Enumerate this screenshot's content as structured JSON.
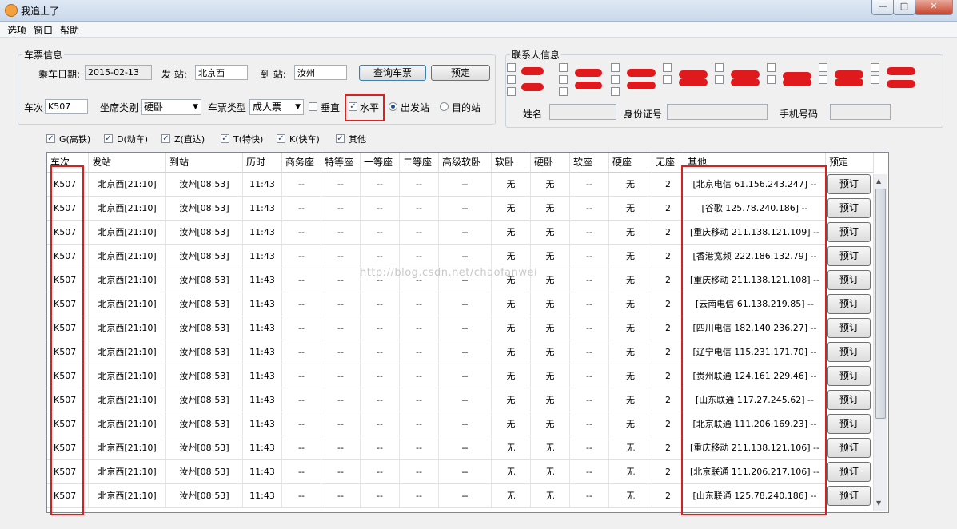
{
  "window": {
    "title": "我追上了",
    "minimize": "—",
    "maximize": "□",
    "close": "✕"
  },
  "menu": [
    "选项",
    "窗口",
    "帮助"
  ],
  "ticket": {
    "group_label": "车票信息",
    "date_label": "乘车日期:",
    "date_value": "2015-02-13",
    "from_label": "发 站:",
    "from_value": "北京西",
    "to_label": "到 站:",
    "to_value": "汝州",
    "query_button": "查询车票",
    "book_button": "预定",
    "train_label": "车次",
    "train_value": "K507",
    "seat_label": "坐席类别",
    "seat_value": "硬卧",
    "ticket_type_label": "车票类型",
    "ticket_type_value": "成人票",
    "vertical_label": "垂直",
    "vertical_checked": false,
    "horizontal_label": "水平",
    "horizontal_checked": true,
    "depart_label": "出发站",
    "dest_label": "目的站",
    "station_mode": "出发站"
  },
  "contacts": {
    "group_label": "联系人信息",
    "name_label": "姓名",
    "id_label": "身份证号",
    "phone_label": "手机号码"
  },
  "filters": [
    {
      "label": "G(高铁)",
      "checked": true
    },
    {
      "label": "D(动车)",
      "checked": true
    },
    {
      "label": "Z(直达)",
      "checked": true
    },
    {
      "label": "T(特快)",
      "checked": true
    },
    {
      "label": "K(快车)",
      "checked": true
    },
    {
      "label": "其他",
      "checked": true
    }
  ],
  "table": {
    "columns": [
      "车次",
      "发站",
      "到站",
      "历时",
      "商务座",
      "特等座",
      "一等座",
      "二等座",
      "高级软卧",
      "软卧",
      "硬卧",
      "软座",
      "硬座",
      "无座",
      "其他",
      "预定"
    ],
    "book_label": "预订",
    "rows": [
      [
        "K507",
        "北京西[21:10]",
        "汝州[08:53]",
        "11:43",
        "--",
        "--",
        "--",
        "--",
        "--",
        "无",
        "无",
        "--",
        "无",
        "2",
        "[北京电信 61.156.243.247] --"
      ],
      [
        "K507",
        "北京西[21:10]",
        "汝州[08:53]",
        "11:43",
        "--",
        "--",
        "--",
        "--",
        "--",
        "无",
        "无",
        "--",
        "无",
        "2",
        "[谷歌 125.78.240.186] --"
      ],
      [
        "K507",
        "北京西[21:10]",
        "汝州[08:53]",
        "11:43",
        "--",
        "--",
        "--",
        "--",
        "--",
        "无",
        "无",
        "--",
        "无",
        "2",
        "[重庆移动 211.138.121.109] --"
      ],
      [
        "K507",
        "北京西[21:10]",
        "汝州[08:53]",
        "11:43",
        "--",
        "--",
        "--",
        "--",
        "--",
        "无",
        "无",
        "--",
        "无",
        "2",
        "[香港宽频 222.186.132.79] --"
      ],
      [
        "K507",
        "北京西[21:10]",
        "汝州[08:53]",
        "11:43",
        "--",
        "--",
        "--",
        "--",
        "--",
        "无",
        "无",
        "--",
        "无",
        "2",
        "[重庆移动 211.138.121.108] --"
      ],
      [
        "K507",
        "北京西[21:10]",
        "汝州[08:53]",
        "11:43",
        "--",
        "--",
        "--",
        "--",
        "--",
        "无",
        "无",
        "--",
        "无",
        "2",
        "[云南电信 61.138.219.85] --"
      ],
      [
        "K507",
        "北京西[21:10]",
        "汝州[08:53]",
        "11:43",
        "--",
        "--",
        "--",
        "--",
        "--",
        "无",
        "无",
        "--",
        "无",
        "2",
        "[四川电信 182.140.236.27] --"
      ],
      [
        "K507",
        "北京西[21:10]",
        "汝州[08:53]",
        "11:43",
        "--",
        "--",
        "--",
        "--",
        "--",
        "无",
        "无",
        "--",
        "无",
        "2",
        "[辽宁电信 115.231.171.70] --"
      ],
      [
        "K507",
        "北京西[21:10]",
        "汝州[08:53]",
        "11:43",
        "--",
        "--",
        "--",
        "--",
        "--",
        "无",
        "无",
        "--",
        "无",
        "2",
        "[贵州联通 124.161.229.46] --"
      ],
      [
        "K507",
        "北京西[21:10]",
        "汝州[08:53]",
        "11:43",
        "--",
        "--",
        "--",
        "--",
        "--",
        "无",
        "无",
        "--",
        "无",
        "2",
        "[山东联通 117.27.245.62] --"
      ],
      [
        "K507",
        "北京西[21:10]",
        "汝州[08:53]",
        "11:43",
        "--",
        "--",
        "--",
        "--",
        "--",
        "无",
        "无",
        "--",
        "无",
        "2",
        "[北京联通 111.206.169.23] --"
      ],
      [
        "K507",
        "北京西[21:10]",
        "汝州[08:53]",
        "11:43",
        "--",
        "--",
        "--",
        "--",
        "--",
        "无",
        "无",
        "--",
        "无",
        "2",
        "[重庆移动 211.138.121.106] --"
      ],
      [
        "K507",
        "北京西[21:10]",
        "汝州[08:53]",
        "11:43",
        "--",
        "--",
        "--",
        "--",
        "--",
        "无",
        "无",
        "--",
        "无",
        "2",
        "[北京联通 111.206.217.106] --"
      ],
      [
        "K507",
        "北京西[21:10]",
        "汝州[08:53]",
        "11:43",
        "--",
        "--",
        "--",
        "--",
        "--",
        "无",
        "无",
        "--",
        "无",
        "2",
        "[山东联通 125.78.240.186] --"
      ]
    ]
  },
  "watermark": "http://blog.csdn.net/chaofanwei",
  "colors": {
    "highlight": "#d82020",
    "checkmark": "#1c3f8c"
  }
}
